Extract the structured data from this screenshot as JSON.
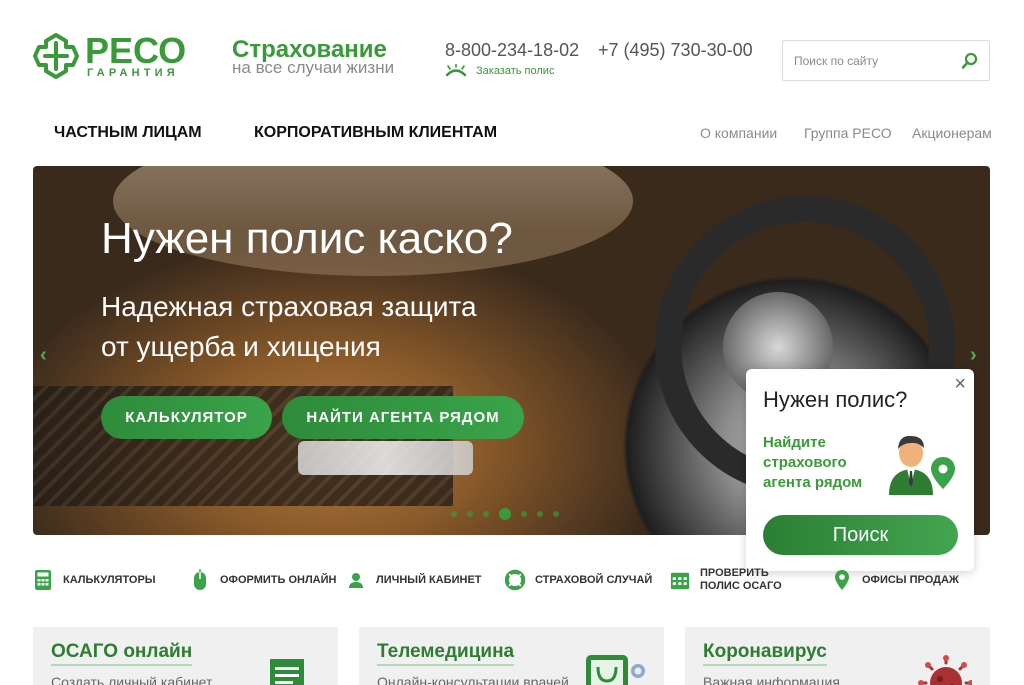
{
  "brand": {
    "name": "РЕСО",
    "subtitle": "ГАРАНТИЯ",
    "color": "#3a9a3a"
  },
  "slogan": {
    "title": "Страхование",
    "subtitle": "на все случаи жизни"
  },
  "contacts": {
    "phone1": "8-800-234-18-02",
    "phone2": "+7 (495) 730-30-00",
    "order_label": "Заказать полис"
  },
  "search": {
    "placeholder": "Поиск по сайту",
    "value": ""
  },
  "nav": {
    "primary": [
      "ЧАСТНЫМ ЛИЦАМ",
      "КОРПОРАТИВНЫМ КЛИЕНТАМ"
    ],
    "secondary": [
      "О компании",
      "Группа РЕСО",
      "Акционерам"
    ]
  },
  "hero": {
    "title": "Нужен полис каско?",
    "subtitle_line1": "Надежная страховая защита",
    "subtitle_line2": "от ущерба и хищения",
    "buttons": [
      "КАЛЬКУЛЯТОР",
      "НАЙТИ АГЕНТА РЯДОМ"
    ],
    "prev_arrow": "‹",
    "next_arrow": "›",
    "slides_total": 7,
    "active_slide": 4
  },
  "popup": {
    "title": "Нужен полис?",
    "text": "Найдите страхового агента рядом",
    "button": "Поиск",
    "close": "×"
  },
  "quick_links": [
    {
      "label": "КАЛЬКУЛЯТОРЫ",
      "icon": "calculator-icon"
    },
    {
      "label": "ОФОРМИТЬ ОНЛАЙН",
      "icon": "mouse-icon"
    },
    {
      "label": "ЛИЧНЫЙ КАБИНЕТ",
      "icon": "user-icon"
    },
    {
      "label": "СТРАХОВОЙ СЛУЧАЙ",
      "icon": "lifebuoy-icon"
    },
    {
      "label": "ПРОВЕРИТЬ ПОЛИС ОСАГО",
      "icon": "calendar-icon"
    },
    {
      "label": "ОФИСЫ ПРОДАЖ",
      "icon": "map-pin-icon"
    }
  ],
  "cards": [
    {
      "title": "ОСАГО онлайн",
      "text": "Создать личный кабинет"
    },
    {
      "title": "Телемедицина",
      "text": "Онлайн-консультации врачей"
    },
    {
      "title": "Коронавирус",
      "text": "Важная информация"
    }
  ]
}
